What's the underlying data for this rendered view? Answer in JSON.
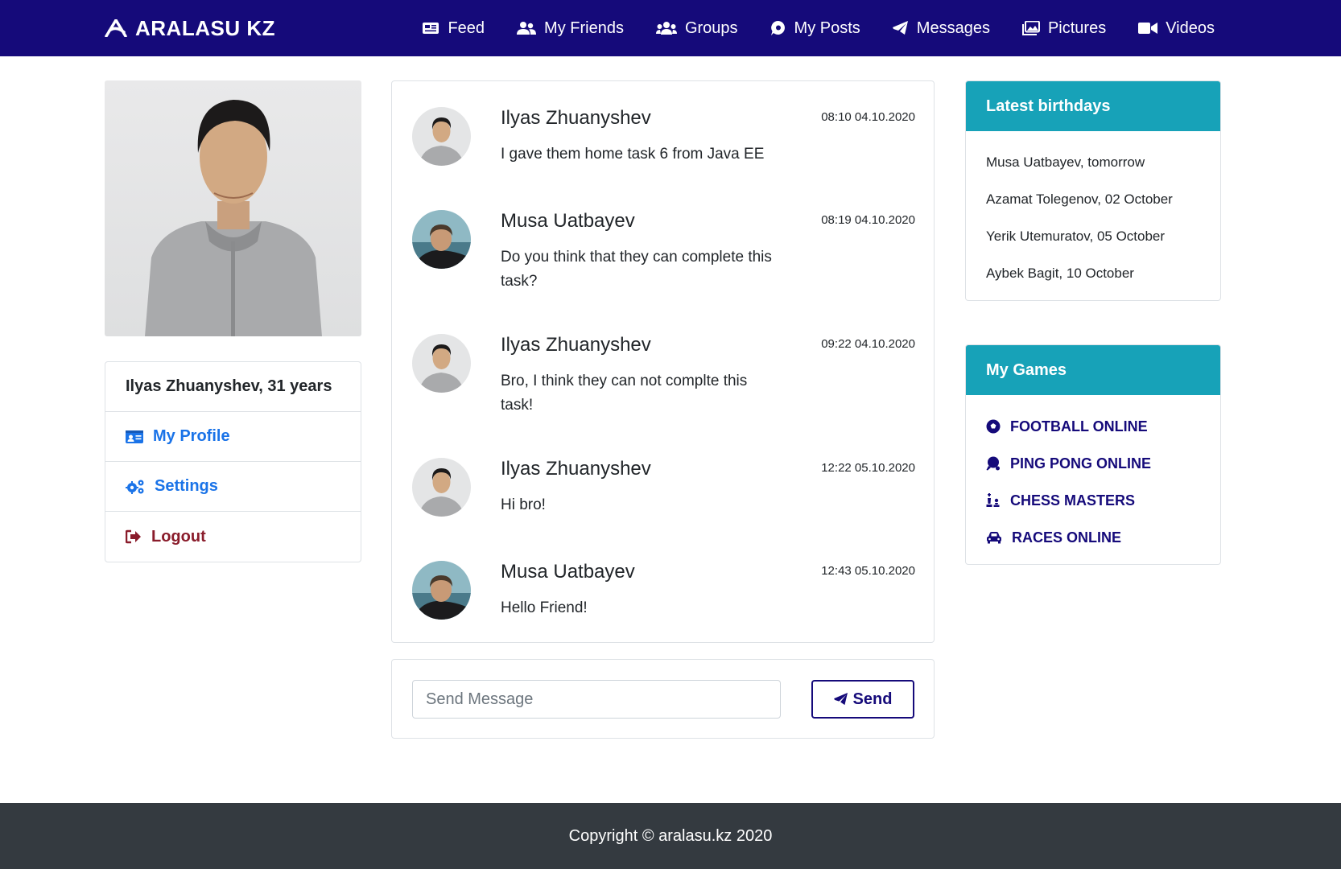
{
  "brand": {
    "name": "ARALASU KZ"
  },
  "nav": {
    "items": [
      {
        "label": "Feed",
        "icon": "newspaper-icon"
      },
      {
        "label": "My Friends",
        "icon": "user-friends-icon"
      },
      {
        "label": "Groups",
        "icon": "users-icon"
      },
      {
        "label": "My Posts",
        "icon": "comment-icon"
      },
      {
        "label": "Messages",
        "icon": "paper-plane-icon"
      },
      {
        "label": "Pictures",
        "icon": "images-icon"
      },
      {
        "label": "Videos",
        "icon": "video-icon"
      }
    ]
  },
  "profile": {
    "summary": "Ilyas Zhuanyshev, 31 years",
    "menu": [
      {
        "label": "My Profile",
        "icon": "id-card-icon"
      },
      {
        "label": "Settings",
        "icon": "cogs-icon"
      },
      {
        "label": "Logout",
        "icon": "sign-out-icon"
      }
    ]
  },
  "messages": [
    {
      "author": "Ilyas Zhuanyshev",
      "time": "08:10 04.10.2020",
      "text": "I gave them home task 6 from Java EE"
    },
    {
      "author": "Musa Uatbayev",
      "time": "08:19 04.10.2020",
      "text": "Do you think that they can complete this task?"
    },
    {
      "author": "Ilyas Zhuanyshev",
      "time": "09:22 04.10.2020",
      "text": "Bro, I think they can not complte this task!"
    },
    {
      "author": "Ilyas Zhuanyshev",
      "time": "12:22 05.10.2020",
      "text": "Hi bro!"
    },
    {
      "author": "Musa Uatbayev",
      "time": "12:43 05.10.2020",
      "text": "Hello Friend!"
    }
  ],
  "composer": {
    "placeholder": "Send Message",
    "send_label": "Send"
  },
  "birthdays": {
    "title": "Latest birthdays",
    "items": [
      "Musa Uatbayev, tomorrow",
      "Azamat Tolegenov, 02 October",
      "Yerik Utemuratov, 05 October",
      "Aybek Bagit, 10 October"
    ]
  },
  "games": {
    "title": "My Games",
    "items": [
      {
        "label": "FOOTBALL ONLINE",
        "icon": "futbol-icon"
      },
      {
        "label": "PING PONG ONLINE",
        "icon": "table-tennis-icon"
      },
      {
        "label": "CHESS MASTERS",
        "icon": "chess-icon"
      },
      {
        "label": "RACES ONLINE",
        "icon": "car-icon"
      }
    ]
  },
  "footer": {
    "text": "Copyright © aralasu.kz 2020"
  },
  "colors": {
    "navbar": "#150a7a",
    "accent": "#17a2b8",
    "link": "#1a73e8",
    "logout": "#8a1c2b",
    "footer": "#343a40"
  }
}
